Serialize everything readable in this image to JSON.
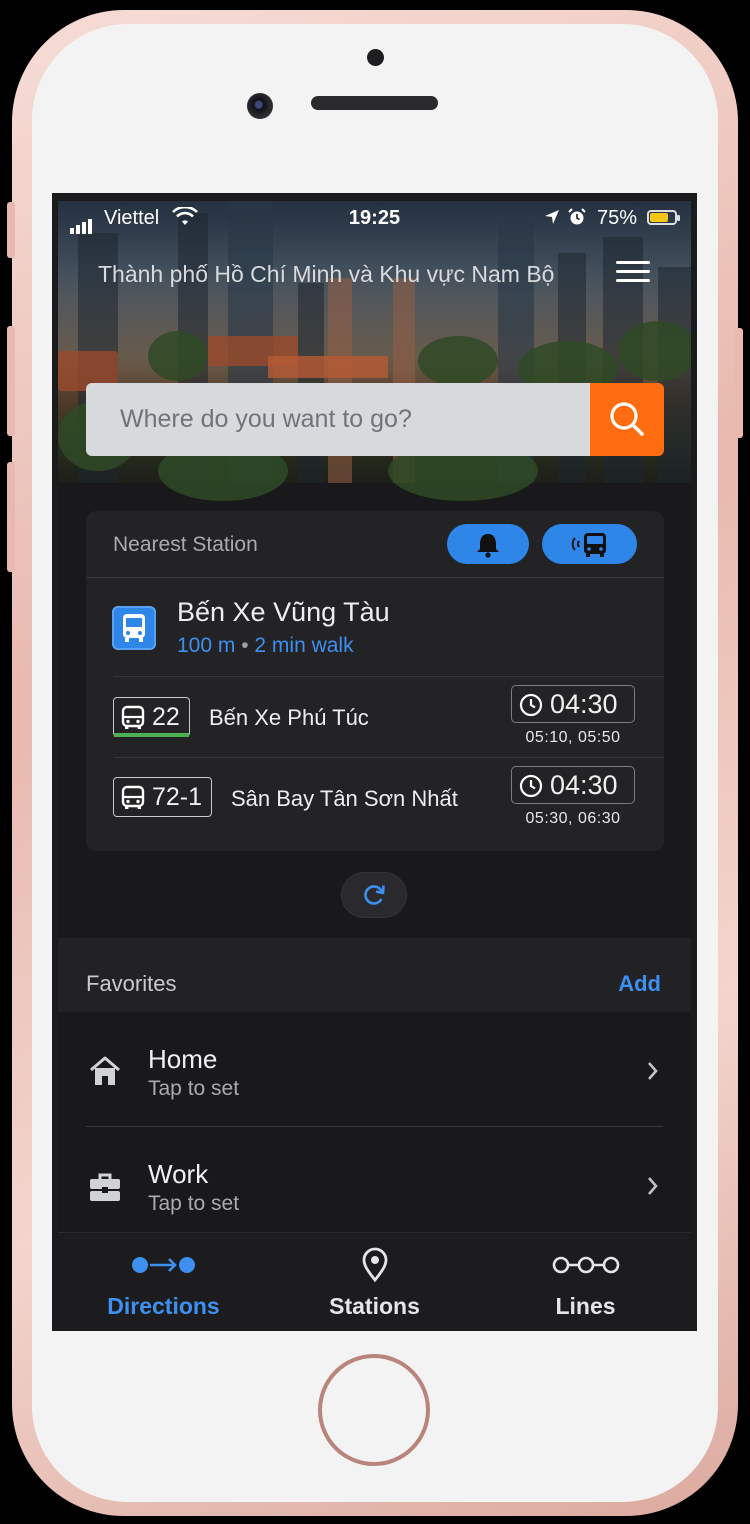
{
  "status_bar": {
    "carrier": "Viettel",
    "time": "19:25",
    "battery_percent": "75%",
    "battery_level": 0.75
  },
  "header": {
    "region": "Thành phố Hồ Chí Minh và Khu vực Nam Bộ"
  },
  "search": {
    "placeholder": "Where do you want to go?"
  },
  "nearest_station": {
    "section_label": "Nearest Station",
    "name": "Bến Xe Vũng Tàu",
    "distance": "100 m",
    "walk": "2 min walk",
    "routes": [
      {
        "number": "22",
        "destination": "Bến Xe Phú Túc",
        "eta": "04:30",
        "next": "05:10, 05:50",
        "line_color": "#4caf50"
      },
      {
        "number": "72-1",
        "destination": "Sân Bay Tân Sơn Nhất",
        "eta": "04:30",
        "next": "05:30, 06:30"
      }
    ]
  },
  "favorites": {
    "section_label": "Favorites",
    "add_label": "Add",
    "items": [
      {
        "title": "Home",
        "subtitle": "Tap to set"
      },
      {
        "title": "Work",
        "subtitle": "Tap to set"
      }
    ]
  },
  "tabbar": {
    "tabs": [
      {
        "label": "Directions",
        "active": true
      },
      {
        "label": "Stations",
        "active": false
      },
      {
        "label": "Lines",
        "active": false
      }
    ]
  },
  "colors": {
    "accent_blue": "#2e86e8",
    "search_orange": "#ff6d10",
    "background": "#19191b",
    "card": "#232326"
  }
}
